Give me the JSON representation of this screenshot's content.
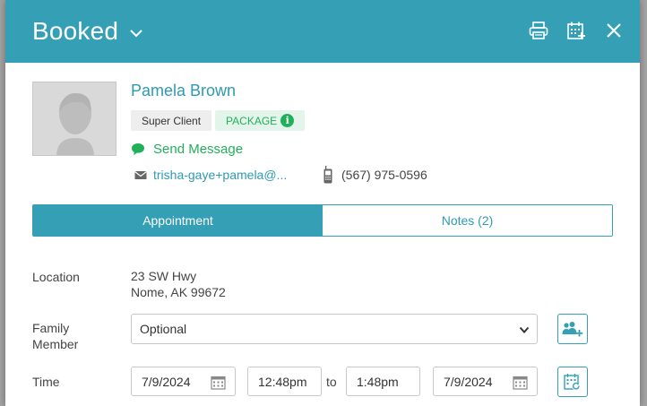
{
  "modal": {
    "title": "Booked"
  },
  "client": {
    "name": "Pamela Brown",
    "badges": {
      "super": "Super Client",
      "package": "PACKAGE",
      "package_info": "i"
    },
    "send_message": "Send Message",
    "email": "trisha-gaye+pamela@...",
    "phone": "(567) 975-0596"
  },
  "tabs": [
    {
      "label": "Appointment",
      "active": true
    },
    {
      "label": "Notes (2)",
      "active": false
    }
  ],
  "form": {
    "location_label": "Location",
    "location_line1": "23 SW Hwy",
    "location_line2": "Nome, AK 99672",
    "family_label_line1": "Family",
    "family_label_line2": "Member",
    "family_value": "Optional",
    "time_label": "Time",
    "start_date": "7/9/2024",
    "start_time": "12:48pm",
    "to_label": "to",
    "end_time": "1:48pm",
    "end_date": "7/9/2024"
  },
  "colors": {
    "header": "#349fb5",
    "accent_text": "#2f9ab2",
    "green": "#21b05a"
  },
  "icons": [
    "chevron-down-icon",
    "print-icon",
    "calendar-add-icon",
    "close-icon",
    "chat-bubble-icon",
    "envelope-icon",
    "mobile-phone-icon",
    "add-family-icon",
    "calendar-icon",
    "calendar-refresh-icon"
  ]
}
